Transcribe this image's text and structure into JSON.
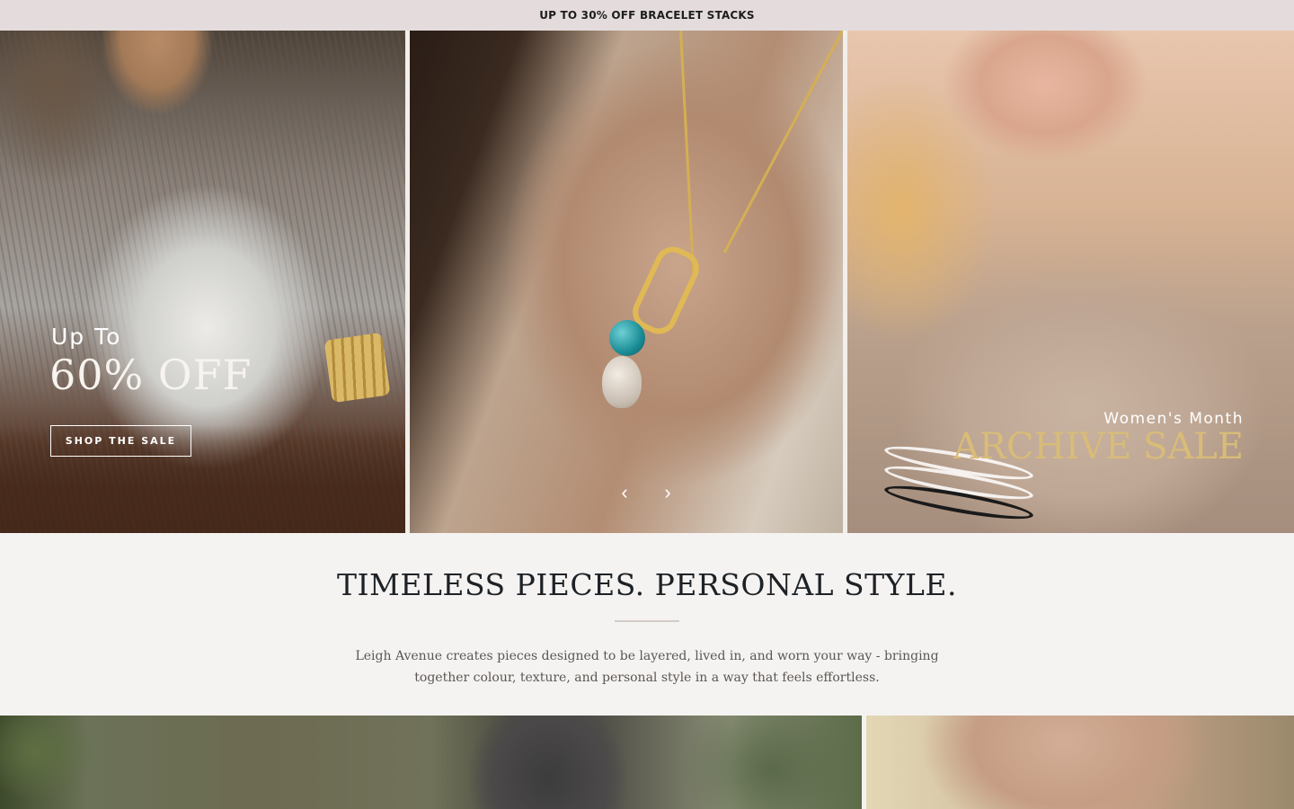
{
  "announcement": {
    "text": "UP TO 30% OFF BRACELET STACKS"
  },
  "hero": {
    "panel_left": {
      "line1": "Up To",
      "line2": "60% OFF",
      "button_label": "SHOP THE SALE"
    },
    "panel_right": {
      "line1": "Women's Month",
      "line2": "ARCHIVE SALE"
    },
    "carousel": {
      "prev_icon": "chevron-left-icon",
      "next_icon": "chevron-right-icon",
      "prev_glyph": "‹",
      "next_glyph": "›"
    }
  },
  "intro": {
    "heading": "TIMELESS PIECES. PERSONAL STYLE.",
    "body": "Leigh Avenue creates pieces designed to be layered, lived in, and worn your way - bringing together colour, texture, and personal style in a way that feels effortless."
  },
  "colors": {
    "announcement_bg": "#e4dcdc",
    "page_bg": "#f5f3f1",
    "heading": "#1e2226",
    "archive_gold": "#d8bc78"
  }
}
